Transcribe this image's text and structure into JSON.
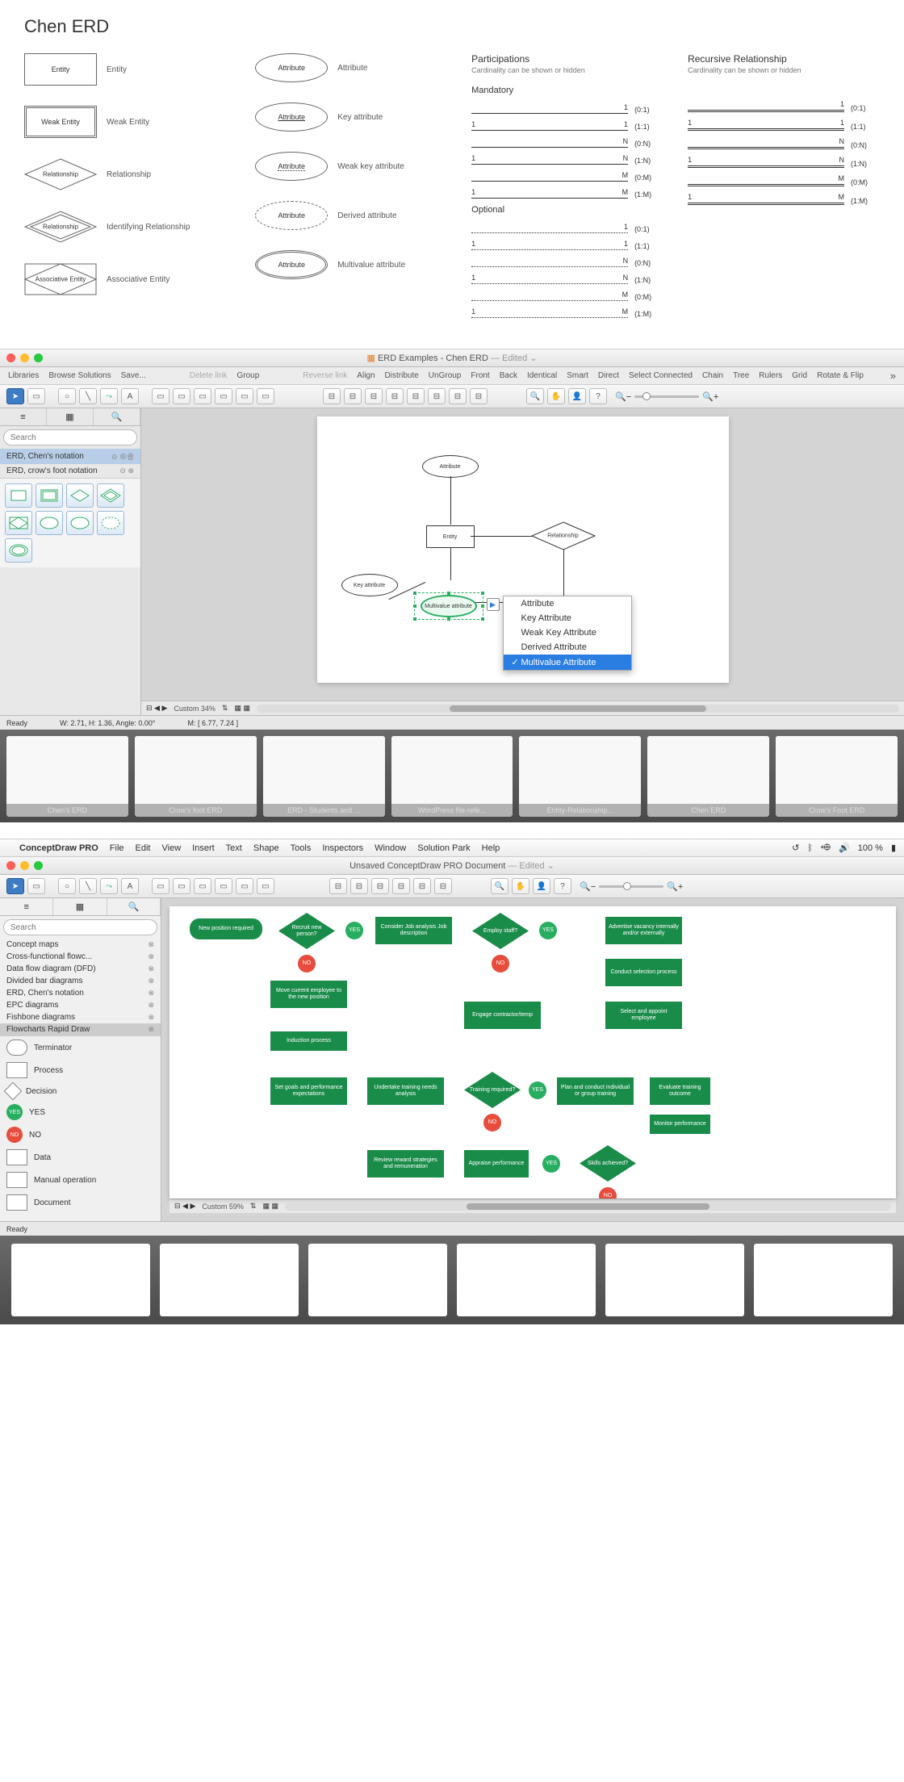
{
  "chen": {
    "title": "Chen ERD",
    "shapes_left": [
      {
        "text": "Entity",
        "label": "Entity"
      },
      {
        "text": "Weak Entity",
        "label": "Weak Entity"
      },
      {
        "text": "Relationship",
        "label": "Relationship"
      },
      {
        "text": "Relationship",
        "label": "Identifying Relationship"
      },
      {
        "text": "Associative Entity",
        "label": "Associative Entity"
      }
    ],
    "shapes_mid": [
      {
        "text": "Attribute",
        "label": "Attribute"
      },
      {
        "text": "Attribute",
        "label": "Key attribute"
      },
      {
        "text": "Attribute",
        "label": "Weak key attribute"
      },
      {
        "text": "Attribute",
        "label": "Derived attribute"
      },
      {
        "text": "Attribute",
        "label": "Multivalue attribute"
      }
    ],
    "participations": {
      "title": "Participations",
      "sub": "Cardinality can be shown or hidden",
      "mandatory": "Mandatory",
      "optional": "Optional",
      "lines_mandatory": [
        {
          "l": "",
          "r": "1",
          "n": "(0:1)"
        },
        {
          "l": "1",
          "r": "1",
          "n": "(1:1)"
        },
        {
          "l": "",
          "r": "N",
          "n": "(0:N)"
        },
        {
          "l": "1",
          "r": "N",
          "n": "(1:N)"
        },
        {
          "l": "",
          "r": "M",
          "n": "(0:M)"
        },
        {
          "l": "1",
          "r": "M",
          "n": "(1:M)"
        }
      ],
      "lines_optional": [
        {
          "l": "",
          "r": "1",
          "n": "(0:1)"
        },
        {
          "l": "1",
          "r": "1",
          "n": "(1:1)"
        },
        {
          "l": "",
          "r": "N",
          "n": "(0:N)"
        },
        {
          "l": "1",
          "r": "N",
          "n": "(1:N)"
        },
        {
          "l": "",
          "r": "M",
          "n": "(0:M)"
        },
        {
          "l": "1",
          "r": "M",
          "n": "(1:M)"
        }
      ]
    },
    "recursive": {
      "title": "Recursive Relationship",
      "sub": "Cardinality can be shown or hidden",
      "lines": [
        {
          "l": "",
          "r": "1",
          "n": "(0:1)"
        },
        {
          "l": "1",
          "r": "1",
          "n": "(1:1)"
        },
        {
          "l": "",
          "r": "N",
          "n": "(0:N)"
        },
        {
          "l": "1",
          "r": "N",
          "n": "(1:N)"
        },
        {
          "l": "",
          "r": "M",
          "n": "(0:M)"
        },
        {
          "l": "1",
          "r": "M",
          "n": "(1:M)"
        }
      ]
    }
  },
  "win1": {
    "title": "ERD Examples - Chen ERD",
    "edited": "— Edited ⌄",
    "menu": [
      "Libraries",
      "Browse Solutions",
      "Save..."
    ],
    "menu_dim": "Delete link",
    "menu2": [
      "Group"
    ],
    "menu_dim2": "Reverse link",
    "menu3": [
      "Align",
      "Distribute",
      "UnGroup",
      "Front",
      "Back",
      "Identical",
      "Smart",
      "Direct",
      "Select Connected",
      "Chain",
      "Tree",
      "Rulers",
      "Grid",
      "Rotate & Flip"
    ],
    "search_ph": "Search",
    "libs": [
      "ERD, Chen's notation",
      "ERD, crow's foot notation"
    ],
    "zoom": "Custom 34%",
    "status_ready": "Ready",
    "status_dims": "W: 2.71,  H: 1.36,  Angle: 0.00°",
    "status_pos": "M: [ 6.77, 7.24 ]",
    "context": [
      "Attribute",
      "Key Attribute",
      "Weak Key Attribute",
      "Derived Attribute",
      "Multivalue Attribute"
    ],
    "erd": {
      "entity": "Entity",
      "attribute": "Attribute",
      "key_attr": "Key attribute",
      "multi_attr": "Multivalue attribute",
      "relationship": "Relationship"
    },
    "gallery": [
      "Chen's ERD",
      "Crow's foot ERD",
      "ERD - Students and ...",
      "WordPress file-refe...",
      "Entity-Relationship...",
      "Chen ERD",
      "Crow's Foot ERD"
    ]
  },
  "win2": {
    "mac_menu": [
      "ConceptDraw PRO",
      "File",
      "Edit",
      "View",
      "Insert",
      "Text",
      "Shape",
      "Tools",
      "Inspectors",
      "Window",
      "Solution Park",
      "Help"
    ],
    "battery": "100 %",
    "title": "Unsaved ConceptDraw PRO Document",
    "edited": "— Edited ⌄",
    "search_ph": "Search",
    "libs": [
      "Concept maps",
      "Cross-functional flowc...",
      "Data flow diagram (DFD)",
      "Divided bar diagrams",
      "ERD, Chen's notation",
      "EPC diagrams",
      "Fishbone diagrams",
      "Flowcharts Rapid Draw"
    ],
    "shapes": [
      "Terminator",
      "Process",
      "Decision",
      "YES",
      "NO",
      "Data",
      "Manual operation",
      "Document"
    ],
    "zoom": "Custom 59%",
    "status_ready": "Ready",
    "flow": {
      "new_pos": "New position required",
      "recruit": "Recruit new person?",
      "consider": "Consider Job analysis Job description",
      "employ": "Employ staff?",
      "advertise": "Advertise vacancy internally and/or externally",
      "conduct_sel": "Conduct selection process",
      "move": "Move current employee to the new position",
      "engage": "Engage contractor/temp",
      "select_appoint": "Select and appoint employee",
      "induction": "Induction process",
      "set_goals": "Set goals and performance expectations",
      "undertake": "Undertake training needs analysis",
      "training": "Training required?",
      "plan": "Plan and conduct individual or group training",
      "evaluate": "Evaluate training outcome",
      "monitor": "Monitor performance",
      "review": "Review reward strategies and remuneration",
      "appraise": "Appraise performance",
      "skills": "Skills achieved?",
      "yes": "YES",
      "no": "NO"
    }
  }
}
